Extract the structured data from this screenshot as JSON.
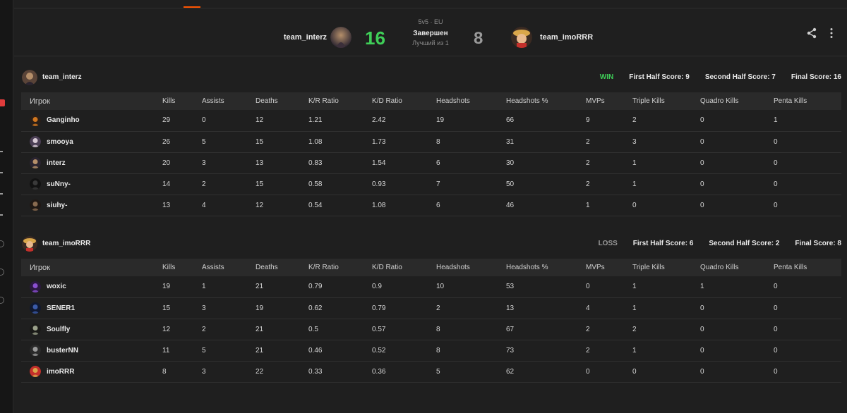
{
  "match": {
    "mode": "5v5 · EU",
    "status": "Завершен",
    "best_of": "Лучший из 1",
    "team1": {
      "name": "team_interz",
      "score": "16"
    },
    "team2": {
      "name": "team_imoRRR",
      "score": "8"
    }
  },
  "columns": [
    "Игрок",
    "Kills",
    "Assists",
    "Deaths",
    "K/R Ratio",
    "K/D Ratio",
    "Headshots",
    "Headshots %",
    "MVPs",
    "Triple Kills",
    "Quadro Kills",
    "Penta Kills"
  ],
  "teams": [
    {
      "name": "team_interz",
      "result": "WIN",
      "first_half": "First Half Score: 9",
      "second_half": "Second Half Score: 7",
      "final": "Final Score: 16",
      "players": [
        {
          "name": "Ganginho",
          "stats": [
            "29",
            "0",
            "12",
            "1.21",
            "2.42",
            "19",
            "66",
            "9",
            "2",
            "0",
            "1"
          ]
        },
        {
          "name": "smooya",
          "stats": [
            "26",
            "5",
            "15",
            "1.08",
            "1.73",
            "8",
            "31",
            "2",
            "3",
            "0",
            "0"
          ]
        },
        {
          "name": "interz",
          "stats": [
            "20",
            "3",
            "13",
            "0.83",
            "1.54",
            "6",
            "30",
            "2",
            "1",
            "0",
            "0"
          ]
        },
        {
          "name": "suNny-",
          "stats": [
            "14",
            "2",
            "15",
            "0.58",
            "0.93",
            "7",
            "50",
            "2",
            "1",
            "0",
            "0"
          ]
        },
        {
          "name": "siuhy-",
          "stats": [
            "13",
            "4",
            "12",
            "0.54",
            "1.08",
            "6",
            "46",
            "1",
            "0",
            "0",
            "0"
          ]
        }
      ]
    },
    {
      "name": "team_imoRRR",
      "result": "LOSS",
      "first_half": "First Half Score: 6",
      "second_half": "Second Half Score: 2",
      "final": "Final Score: 8",
      "players": [
        {
          "name": "woxic",
          "stats": [
            "19",
            "1",
            "21",
            "0.79",
            "0.9",
            "10",
            "53",
            "0",
            "1",
            "1",
            "0"
          ]
        },
        {
          "name": "SENER1",
          "stats": [
            "15",
            "3",
            "19",
            "0.62",
            "0.79",
            "2",
            "13",
            "4",
            "1",
            "0",
            "0"
          ]
        },
        {
          "name": "Soulfly",
          "stats": [
            "12",
            "2",
            "21",
            "0.5",
            "0.57",
            "8",
            "67",
            "2",
            "2",
            "0",
            "0"
          ]
        },
        {
          "name": "busterNN",
          "stats": [
            "11",
            "5",
            "21",
            "0.46",
            "0.52",
            "8",
            "73",
            "2",
            "1",
            "0",
            "0"
          ]
        },
        {
          "name": "imoRRR",
          "stats": [
            "8",
            "3",
            "22",
            "0.33",
            "0.36",
            "5",
            "62",
            "0",
            "0",
            "0",
            "0"
          ]
        }
      ]
    }
  ],
  "icons": {
    "share": "share-icon",
    "more": "more-vertical-icon"
  },
  "colors": {
    "win": "#3fcf58",
    "loss": "#9a9a9a",
    "accent": "#ff5500",
    "badge": "#e03c3c"
  }
}
